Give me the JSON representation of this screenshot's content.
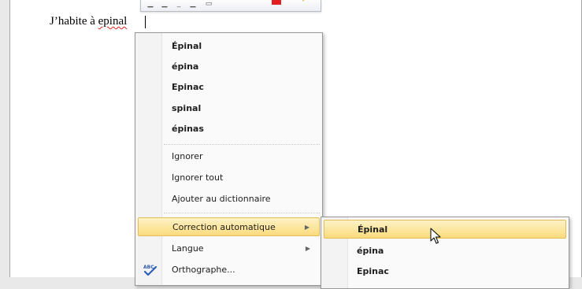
{
  "document": {
    "text_before": "J’habite à ",
    "misspelled_word": "epinal"
  },
  "context_menu": {
    "suggestions": [
      "Épinal",
      "épina",
      "Epinac",
      "spinal",
      "épinas"
    ],
    "actions": [
      {
        "label": "Ignorer"
      },
      {
        "label": "Ignorer tout"
      },
      {
        "label": "Ajouter au dictionnaire"
      }
    ],
    "submenus": [
      {
        "label": "Correction automatique",
        "arrow": "▶",
        "highlighted": true
      },
      {
        "label": "Langue",
        "arrow": "▶"
      },
      {
        "label": "Orthographe...",
        "icon": "spellcheck-icon"
      }
    ]
  },
  "autocorrect_submenu": {
    "items": [
      "Épinal",
      "épina",
      "Epinac"
    ],
    "highlighted_index": 0
  },
  "colors": {
    "highlight_top": "#fdf2c6",
    "highlight_bottom": "#fbdb7c",
    "highlight_border": "#e4be55",
    "misspelling_underline": "#e02020"
  }
}
